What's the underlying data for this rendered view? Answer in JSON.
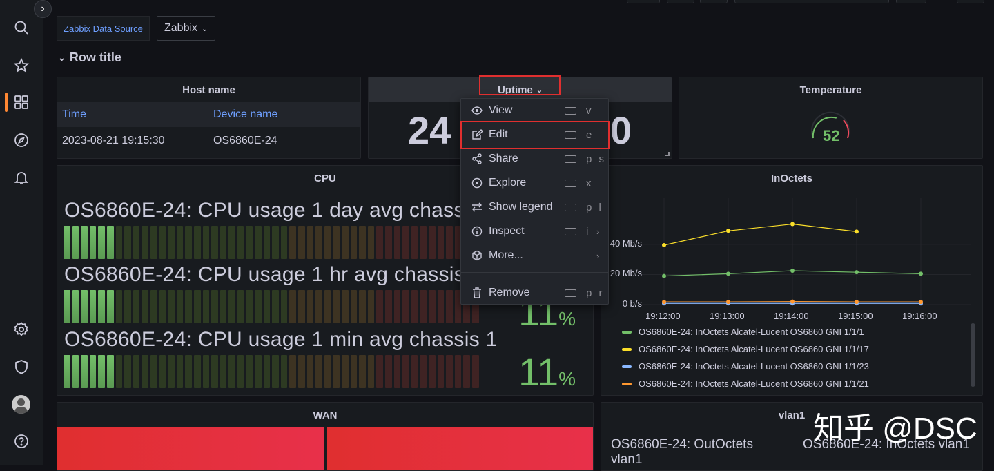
{
  "variables": {
    "datasource_label": "Zabbix Data Source",
    "datasource_value": "Zabbix"
  },
  "row": {
    "title": "Row title"
  },
  "host_panel": {
    "title": "Host name",
    "columns": [
      "Time",
      "Device name"
    ],
    "rows": [
      [
        "2023-08-21 19:15:30",
        "OS6860E-24"
      ]
    ]
  },
  "uptime_panel": {
    "title": "Uptime",
    "value_left": "24",
    "value_right": "0"
  },
  "temperature_panel": {
    "title": "Temperature",
    "value": "52",
    "gauge_fraction": 0.52
  },
  "context_menu": {
    "items": [
      {
        "icon": "eye-icon",
        "label": "View",
        "shortcut": "v"
      },
      {
        "icon": "edit-icon",
        "label": "Edit",
        "shortcut": "e"
      },
      {
        "icon": "share-icon",
        "label": "Share",
        "shortcut": "p s"
      },
      {
        "icon": "compass-icon",
        "label": "Explore",
        "shortcut": "x"
      },
      {
        "icon": "legend-icon",
        "label": "Show legend",
        "shortcut": "p l"
      },
      {
        "icon": "info-icon",
        "label": "Inspect",
        "shortcut": "i"
      },
      {
        "icon": "cube-icon",
        "label": "More...",
        "shortcut": ""
      },
      {
        "icon": "trash-icon",
        "label": "Remove",
        "shortcut": "p r"
      }
    ]
  },
  "cpu_panel": {
    "title": "CPU",
    "rows": [
      {
        "label": "OS6860E-24: CPU usage 1 day avg chassis 1",
        "value": "11",
        "unit": "%",
        "fraction": 0.11
      },
      {
        "label": "OS6860E-24: CPU usage 1 hr avg chassis 1",
        "value": "11",
        "unit": "%",
        "fraction": 0.11
      },
      {
        "label": "OS6860E-24: CPU usage 1 min avg chassis 1",
        "value": "11",
        "unit": "%",
        "fraction": 0.11
      }
    ]
  },
  "inoctets_panel": {
    "title": "InOctets"
  },
  "chart_data": {
    "type": "line",
    "title": "InOctets",
    "x_ticks": [
      "19:12:00",
      "19:13:00",
      "19:14:00",
      "19:15:00",
      "19:16:00"
    ],
    "y_ticks": [
      "0 b/s",
      "20 Mb/s",
      "40 Mb/s"
    ],
    "ylim": [
      0,
      62
    ],
    "grid": true,
    "legend_position": "bottom",
    "series": [
      {
        "name": "OS6860E-24: InOctets Alcatel-Lucent OS6860 GNI 1/1/1",
        "color": "#73bf69",
        "x": [
          "19:12:00",
          "19:13:00",
          "19:14:00",
          "19:15:00",
          "19:16:00"
        ],
        "values": [
          19,
          20.5,
          22.5,
          21.5,
          20.5
        ]
      },
      {
        "name": "OS6860E-24: InOctets Alcatel-Lucent OS6860 GNI 1/1/17",
        "color": "#fade2a",
        "x": [
          "19:12:00",
          "19:13:00",
          "19:14:00",
          "19:15:00"
        ],
        "values": [
          39.5,
          49,
          53.5,
          48.5
        ]
      },
      {
        "name": "OS6860E-24: InOctets Alcatel-Lucent OS6860 GNI 1/1/23",
        "color": "#8ab8ff",
        "x": [
          "19:12:00",
          "19:13:00",
          "19:14:00",
          "19:15:00",
          "19:16:00"
        ],
        "values": [
          0.8,
          0.8,
          0.8,
          0.8,
          0.8
        ]
      },
      {
        "name": "OS6860E-24: InOctets Alcatel-Lucent OS6860 GNI 1/1/21",
        "color": "#ff9830",
        "x": [
          "19:12:00",
          "19:13:00",
          "19:14:00",
          "19:15:00",
          "19:16:00"
        ],
        "values": [
          1.8,
          1.8,
          2.0,
          1.8,
          1.8
        ]
      }
    ]
  },
  "wan_panel": {
    "title": "WAN"
  },
  "vlan_panel": {
    "title": "vlan1",
    "stat_left": "OS6860E-24: OutOctets vlan1",
    "stat_right": "OS6860E-24: InOctets vlan1"
  },
  "watermark": "知乎 @DSC",
  "colors": {
    "accent": "#ff8833",
    "link": "#6e9fff",
    "highlight": "#e02f2f",
    "green": "#73bf69"
  }
}
